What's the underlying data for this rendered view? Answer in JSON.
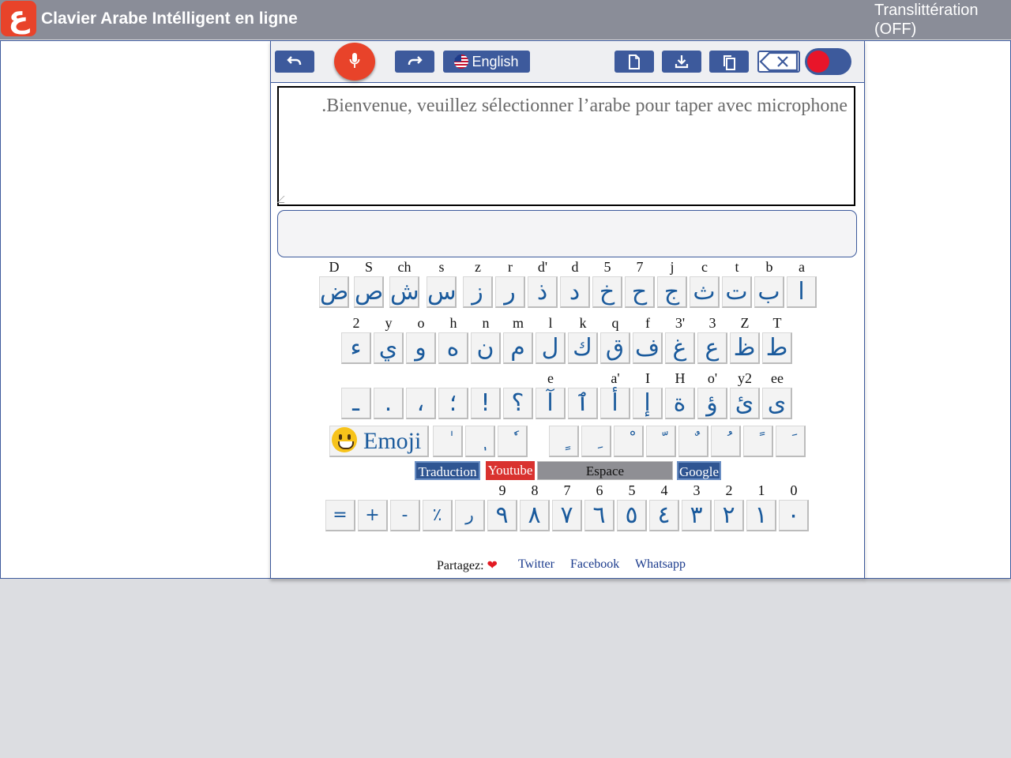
{
  "header": {
    "logo_glyph": "ع",
    "title": "Clavier Arabe Intélligent en ligne",
    "translit_line1": "Translittération",
    "translit_line2": "(OFF)"
  },
  "toolbar": {
    "language": "English",
    "icons": [
      "undo-icon",
      "microphone-icon",
      "redo-icon",
      "new-file-icon",
      "download-icon",
      "copy-icon",
      "backspace-icon",
      "toggle-switch"
    ]
  },
  "editor": {
    "placeholder": "Bienvenue, veuillez sélectionner l’arabe pour taper avec microphone."
  },
  "keyboard": {
    "row1": {
      "labels": [
        "D",
        "S",
        "ch",
        "s",
        "z",
        "r",
        "d'",
        "d",
        "5",
        "7",
        "j",
        "c",
        "t",
        "b",
        "a"
      ],
      "keys": [
        "ض",
        "ص",
        "ش",
        "س",
        "ز",
        "ر",
        "ذ",
        "د",
        "خ",
        "ح",
        "ج",
        "ث",
        "ت",
        "ب",
        "ا"
      ]
    },
    "row2": {
      "labels": [
        "2",
        "y",
        "o",
        "h",
        "n",
        "m",
        "l",
        "k",
        "q",
        "f",
        "3'",
        "3",
        "Z",
        "T"
      ],
      "keys": [
        "ء",
        "ي",
        "و",
        "ه",
        "ن",
        "م",
        "ل",
        "ك",
        "ق",
        "ف",
        "غ",
        "ع",
        "ظ",
        "ط"
      ]
    },
    "row3": {
      "labels": [
        "",
        "",
        "",
        "",
        "",
        "",
        "e",
        "",
        "a'",
        "I",
        "H",
        "o'",
        "y2",
        "ee"
      ],
      "keys": [
        "ـ",
        ".",
        "،",
        "؛",
        "!",
        "؟",
        "آ",
        "ٱ",
        "أ",
        "إ",
        "ة",
        "ؤ",
        "ئ",
        "ى"
      ]
    },
    "row4": {
      "emoji_label": "Emoji",
      "keys_left": [
        "ٰ",
        "ٖ",
        "ٗ"
      ],
      "keys_right": [
        "ٍ",
        "ِ",
        "ْ",
        "ّ",
        "ٌ",
        "ُ",
        "ً",
        "َ"
      ]
    },
    "links": {
      "translate": "Traduction",
      "youtube": "Youtube",
      "space": "Espace",
      "google": "Google"
    },
    "digits": {
      "labels": [
        "9",
        "8",
        "7",
        "6",
        "5",
        "4",
        "3",
        "2",
        "1",
        "0"
      ],
      "keys": [
        "=",
        "+",
        "-",
        "٪",
        "ر",
        "٩",
        "٨",
        "٧",
        "٦",
        "٥",
        "٤",
        "٣",
        "٢",
        "١",
        "٠"
      ]
    }
  },
  "footer": {
    "share_label": "Partagez:",
    "twitter": "Twitter",
    "facebook": "Facebook",
    "whatsapp": "Whatsapp"
  },
  "colors": {
    "header_bg": "#8a8d98",
    "accent_blue": "#3d5a9c",
    "mic_red": "#e8432a",
    "key_text": "#1a5a9c",
    "youtube_red": "#d9322f",
    "space_gray": "#8f8f94"
  }
}
